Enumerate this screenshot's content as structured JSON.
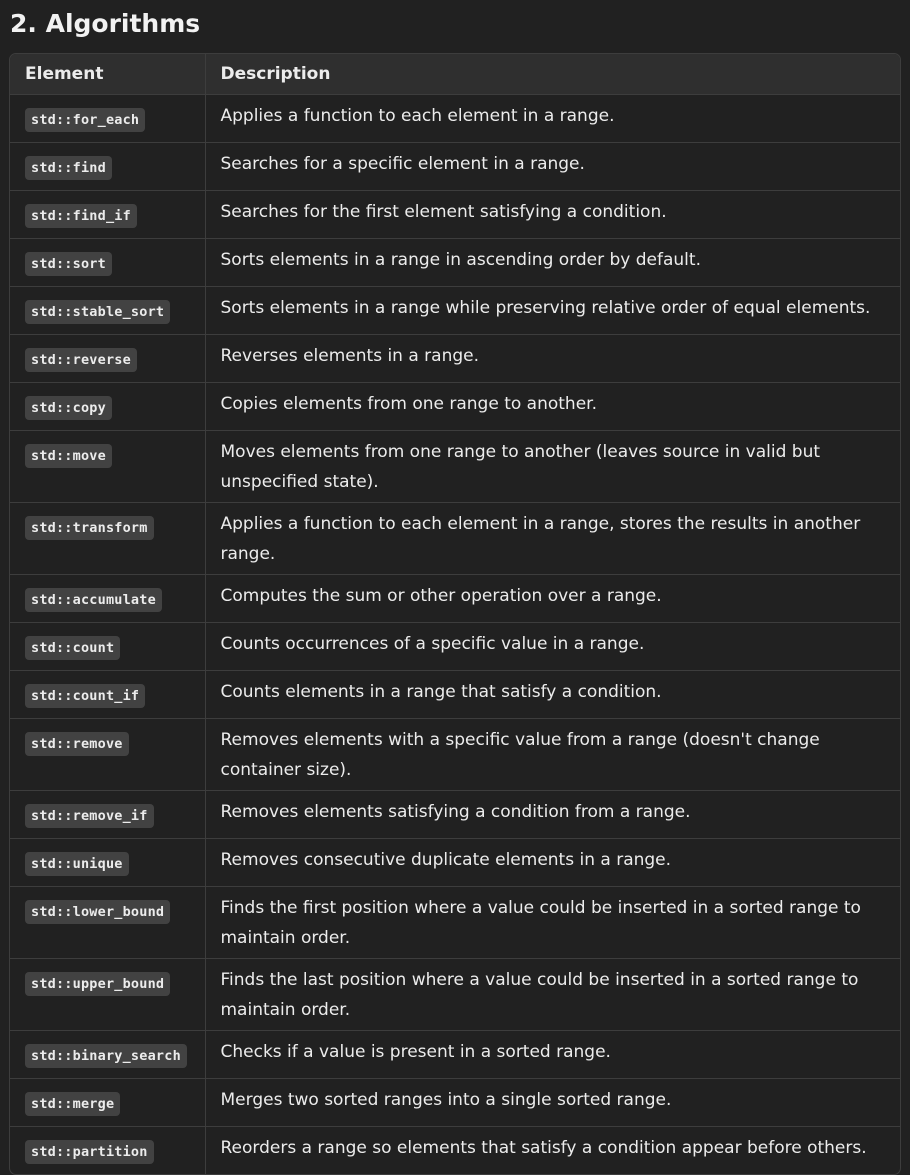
{
  "section": {
    "title": "2. Algorithms"
  },
  "table": {
    "headers": [
      "Element",
      "Description"
    ],
    "rows": [
      {
        "element": "std::for_each",
        "description": "Applies a function to each element in a range."
      },
      {
        "element": "std::find",
        "description": "Searches for a specific element in a range."
      },
      {
        "element": "std::find_if",
        "description": "Searches for the first element satisfying a condition."
      },
      {
        "element": "std::sort",
        "description": "Sorts elements in a range in ascending order by default."
      },
      {
        "element": "std::stable_sort",
        "description": "Sorts elements in a range while preserving relative order of equal elements."
      },
      {
        "element": "std::reverse",
        "description": "Reverses elements in a range."
      },
      {
        "element": "std::copy",
        "description": "Copies elements from one range to another."
      },
      {
        "element": "std::move",
        "description": "Moves elements from one range to another (leaves source in valid but unspecified state)."
      },
      {
        "element": "std::transform",
        "description": "Applies a function to each element in a range, stores the results in another range."
      },
      {
        "element": "std::accumulate",
        "description": "Computes the sum or other operation over a range."
      },
      {
        "element": "std::count",
        "description": "Counts occurrences of a specific value in a range."
      },
      {
        "element": "std::count_if",
        "description": "Counts elements in a range that satisfy a condition."
      },
      {
        "element": "std::remove",
        "description": "Removes elements with a specific value from a range (doesn't change container size)."
      },
      {
        "element": "std::remove_if",
        "description": "Removes elements satisfying a condition from a range."
      },
      {
        "element": "std::unique",
        "description": "Removes consecutive duplicate elements in a range."
      },
      {
        "element": "std::lower_bound",
        "description": "Finds the first position where a value could be inserted in a sorted range to maintain order."
      },
      {
        "element": "std::upper_bound",
        "description": "Finds the last position where a value could be inserted in a sorted range to maintain order."
      },
      {
        "element": "std::binary_search",
        "description": "Checks if a value is present in a sorted range."
      },
      {
        "element": "std::merge",
        "description": "Merges two sorted ranges into a single sorted range."
      },
      {
        "element": "std::partition",
        "description": "Reorders a range so elements that satisfy a condition appear before others."
      }
    ]
  },
  "colors": {
    "background": "#212121",
    "header_background": "#2f2f2f",
    "border": "#3d3d3d",
    "code_background": "#424242",
    "text": "#ececec"
  }
}
